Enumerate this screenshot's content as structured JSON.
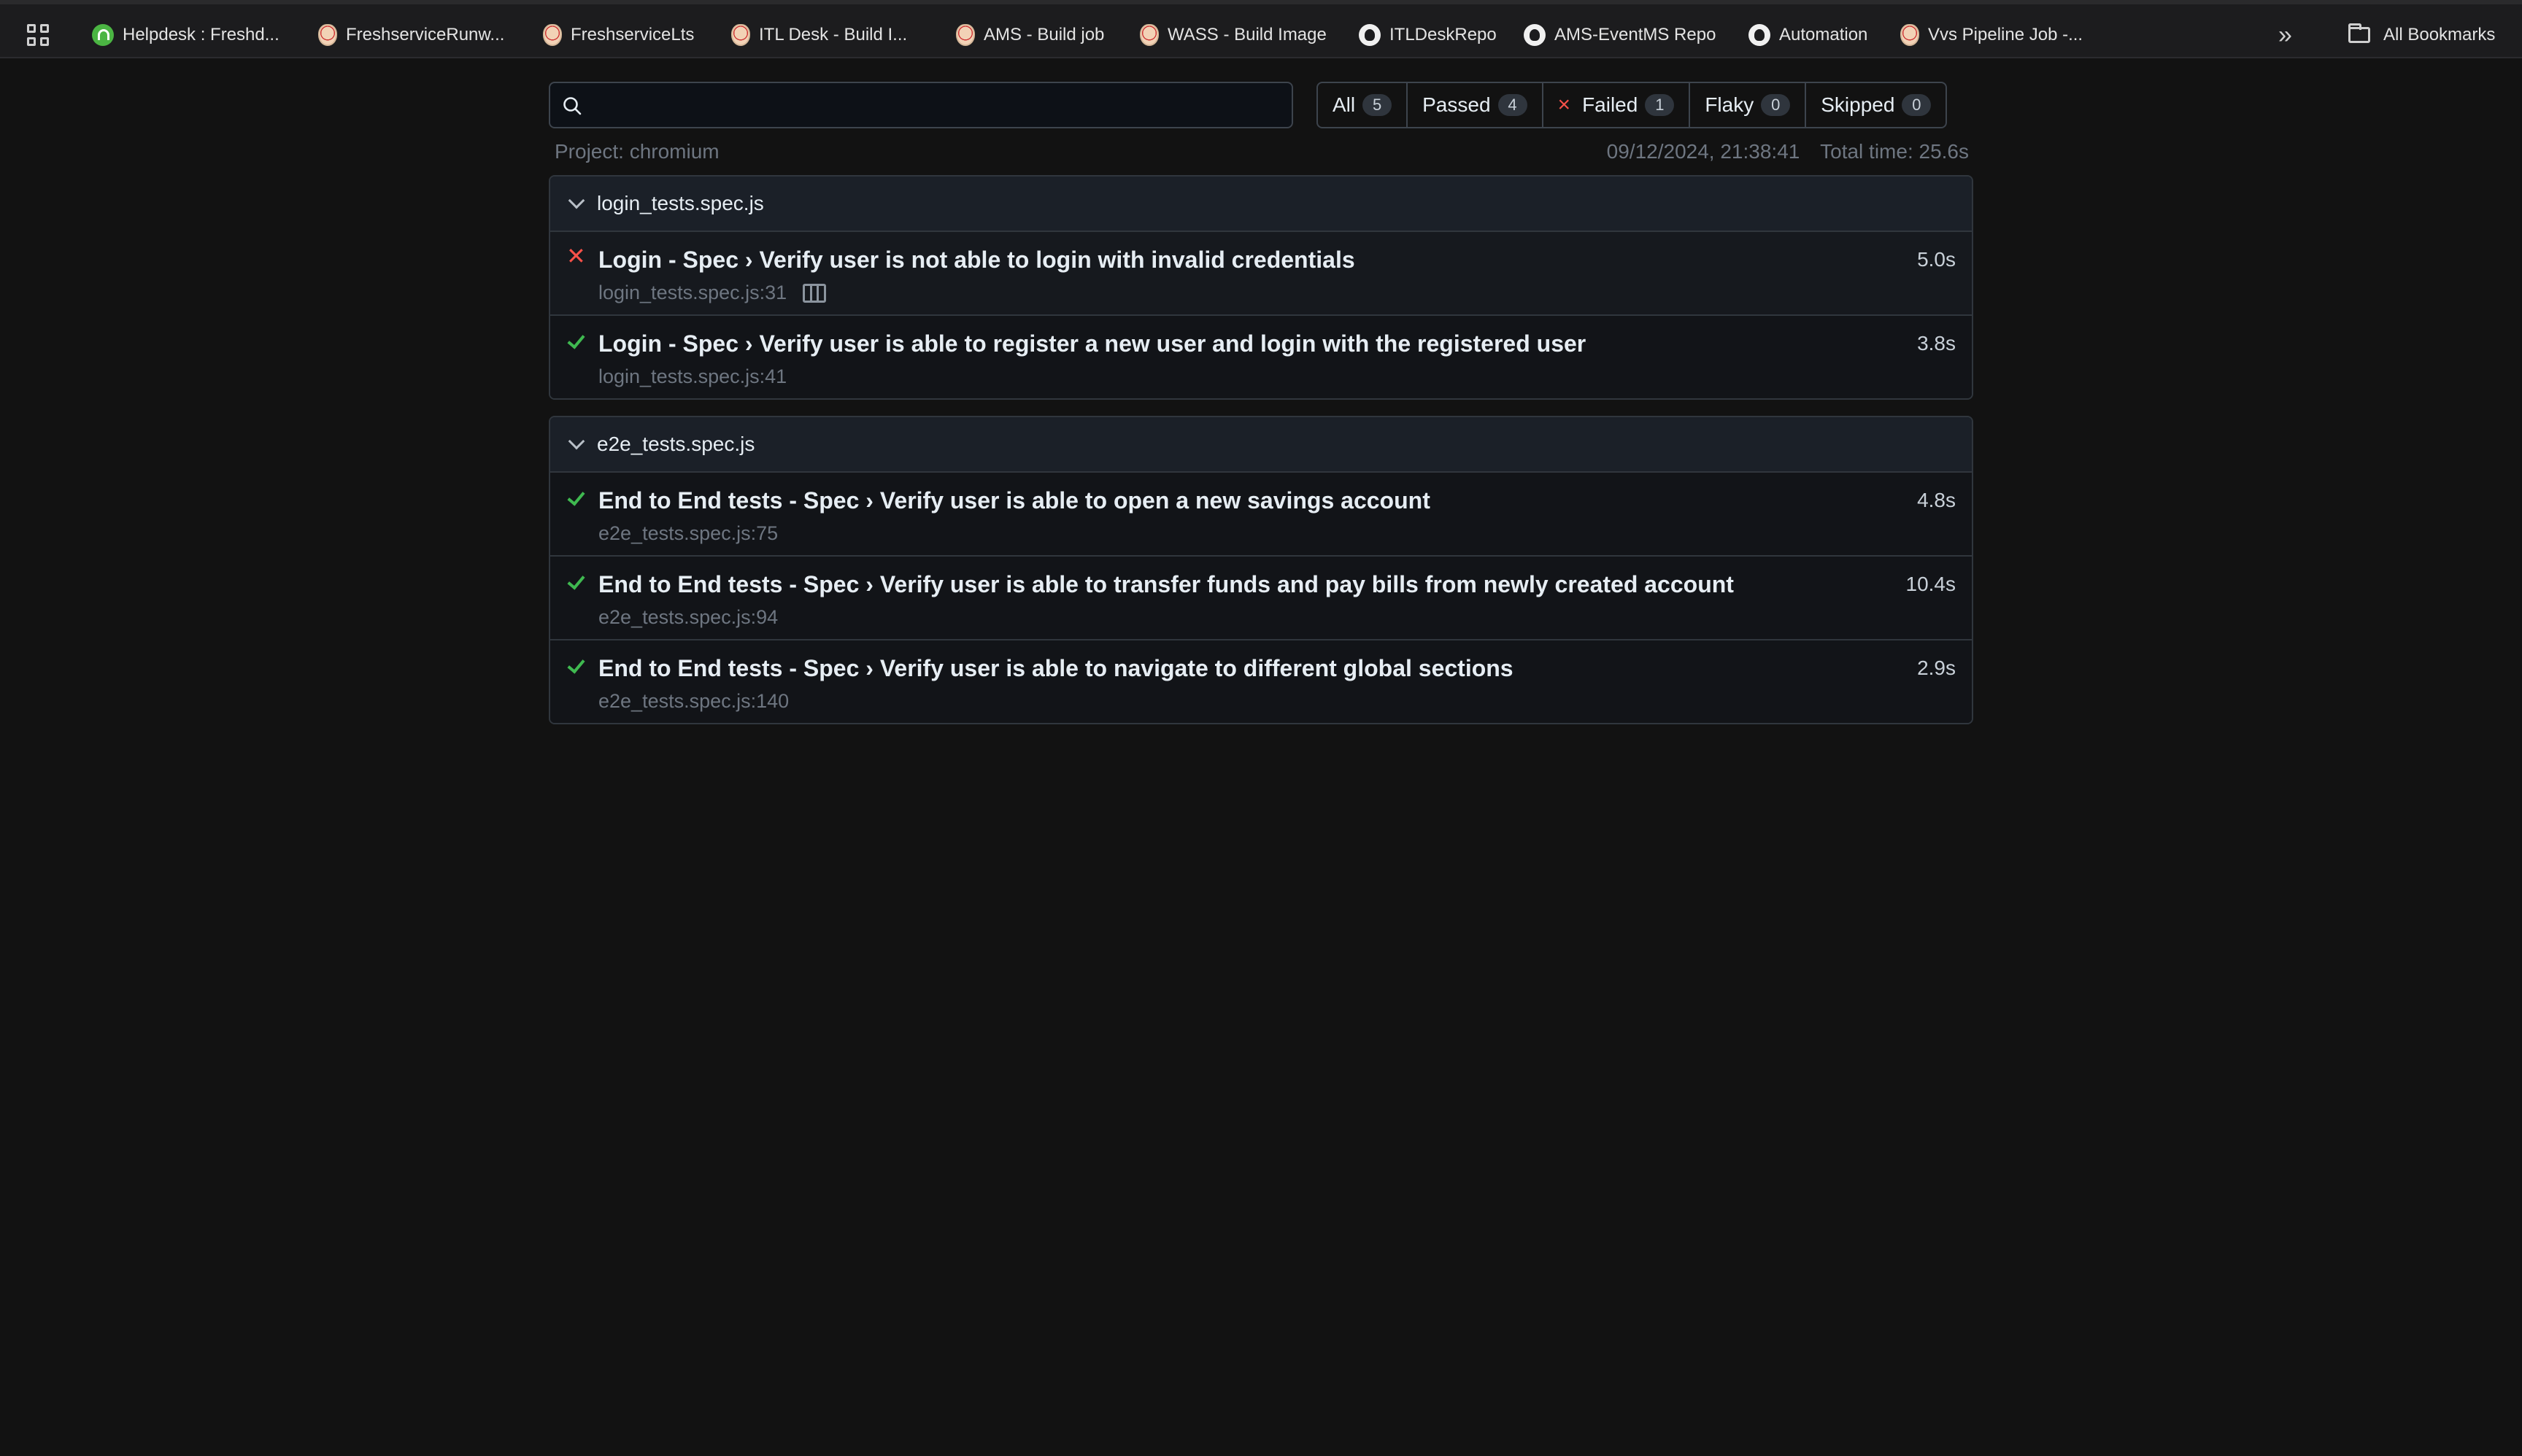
{
  "bookmarks": {
    "items": [
      {
        "label": "Helpdesk : Freshd...",
        "icon": "freshdesk-icon"
      },
      {
        "label": "FreshserviceRunw...",
        "icon": "jenkins-icon"
      },
      {
        "label": "FreshserviceLts",
        "icon": "jenkins-icon"
      },
      {
        "label": "ITL Desk - Build I...",
        "icon": "jenkins-icon"
      },
      {
        "label": "AMS - Build job",
        "icon": "jenkins-icon"
      },
      {
        "label": "WASS - Build Image",
        "icon": "jenkins-icon"
      },
      {
        "label": "ITLDeskRepo",
        "icon": "github-icon"
      },
      {
        "label": "AMS-EventMS Repo",
        "icon": "github-icon"
      },
      {
        "label": "Automation",
        "icon": "github-icon"
      },
      {
        "label": "Vvs Pipeline Job -...",
        "icon": "jenkins-icon"
      }
    ],
    "overflow_label": "»",
    "all_bookmarks_label": "All Bookmarks"
  },
  "search": {
    "value": "",
    "placeholder": ""
  },
  "filters": [
    {
      "label": "All",
      "count": "5"
    },
    {
      "label": "Passed",
      "count": "4"
    },
    {
      "label": "Failed",
      "count": "1",
      "mark": "×"
    },
    {
      "label": "Flaky",
      "count": "0"
    },
    {
      "label": "Skipped",
      "count": "0"
    }
  ],
  "meta": {
    "project": "Project: chromium",
    "timestamp": "09/12/2024, 21:38:41",
    "total_time": "Total time: 25.6s"
  },
  "groups": [
    {
      "file": "login_tests.spec.js",
      "tests": [
        {
          "status": "failed",
          "status_mark": "✕",
          "title": "Login - Spec › Verify user is not able to login with invalid credentials",
          "location": "login_tests.spec.js:31",
          "duration": "5.0s"
        },
        {
          "status": "passed",
          "title": "Login - Spec › Verify user is able to register a new user and login with the registered user",
          "location": "login_tests.spec.js:41",
          "duration": "3.8s"
        }
      ]
    },
    {
      "file": "e2e_tests.spec.js",
      "tests": [
        {
          "status": "passed",
          "title": "End to End tests - Spec › Verify user is able to open a new savings account",
          "location": "e2e_tests.spec.js:75",
          "duration": "4.8s"
        },
        {
          "status": "passed",
          "title": "End to End tests - Spec › Verify user is able to transfer funds and pay bills from newly created account",
          "location": "e2e_tests.spec.js:94",
          "duration": "10.4s"
        },
        {
          "status": "passed",
          "title": "End to End tests - Spec › Verify user is able to navigate to different global sections",
          "location": "e2e_tests.spec.js:140",
          "duration": "2.9s"
        }
      ]
    }
  ],
  "colors": {
    "background": "#121212",
    "passed": "#3fb950",
    "failed": "#f85149",
    "muted_text": "#6e7681"
  }
}
